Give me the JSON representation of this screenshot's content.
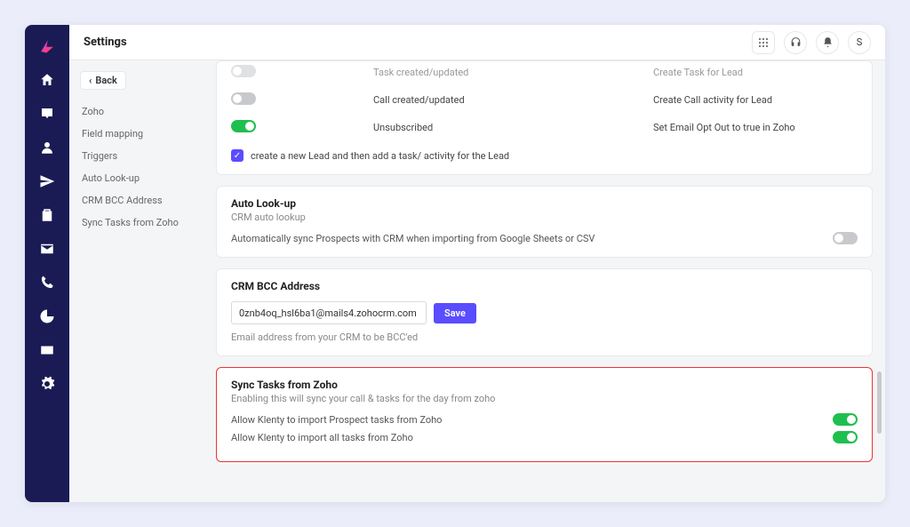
{
  "header": {
    "title": "Settings",
    "avatar_initial": "S"
  },
  "sidepanel": {
    "back_label": "Back",
    "items": [
      "Zoho",
      "Field mapping",
      "Triggers",
      "Auto Look-up",
      "CRM BCC Address",
      "Sync Tasks from Zoho"
    ]
  },
  "triggers": {
    "rows": [
      {
        "toggle": false,
        "event": "Task created/updated",
        "action": "Create Task for Lead"
      },
      {
        "toggle": false,
        "event": "Call created/updated",
        "action": "Create Call activity for Lead"
      },
      {
        "toggle": true,
        "event": "Unsubscribed",
        "action": "Set Email Opt Out to true in Zoho"
      }
    ],
    "checkbox_label": "create a new Lead and then add a task/ activity for the Lead"
  },
  "auto_lookup": {
    "title": "Auto Look-up",
    "subtitle": "CRM auto lookup",
    "desc": "Automatically sync Prospects with CRM when importing from Google Sheets or CSV",
    "toggle": false
  },
  "crm_bcc": {
    "title": "CRM BCC Address",
    "input_value": "0znb4oq_hsl6ba1@mails4.zohocrm.com",
    "save_label": "Save",
    "helper": "Email address from your CRM to be BCC'ed"
  },
  "sync_tasks": {
    "title": "Sync Tasks from Zoho",
    "subtitle": "Enabling this will sync your call & tasks for the day from zoho",
    "rows": [
      {
        "label": "Allow Klenty to import Prospect tasks from Zoho",
        "toggle": true
      },
      {
        "label": "Allow Klenty to import all tasks from Zoho",
        "toggle": true
      }
    ]
  }
}
